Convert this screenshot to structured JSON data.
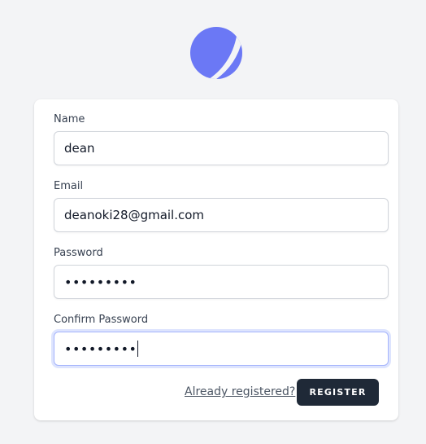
{
  "logo": {
    "icon": "moon-logo-icon",
    "color": "#6b78f5"
  },
  "form": {
    "name": {
      "label": "Name",
      "value": "dean"
    },
    "email": {
      "label": "Email",
      "value": "deanoki28@gmail.com"
    },
    "password": {
      "label": "Password",
      "masked_value": "•••••••••"
    },
    "confirm_password": {
      "label": "Confirm Password",
      "masked_value": "•••••••••",
      "focused": true
    }
  },
  "actions": {
    "already_registered": "Already registered?",
    "register": "REGISTER"
  },
  "colors": {
    "background": "#f3f4f6",
    "card": "#ffffff",
    "button": "#1f2937",
    "accent": "#6b78f5",
    "focus_ring": "#a5b4fc"
  }
}
